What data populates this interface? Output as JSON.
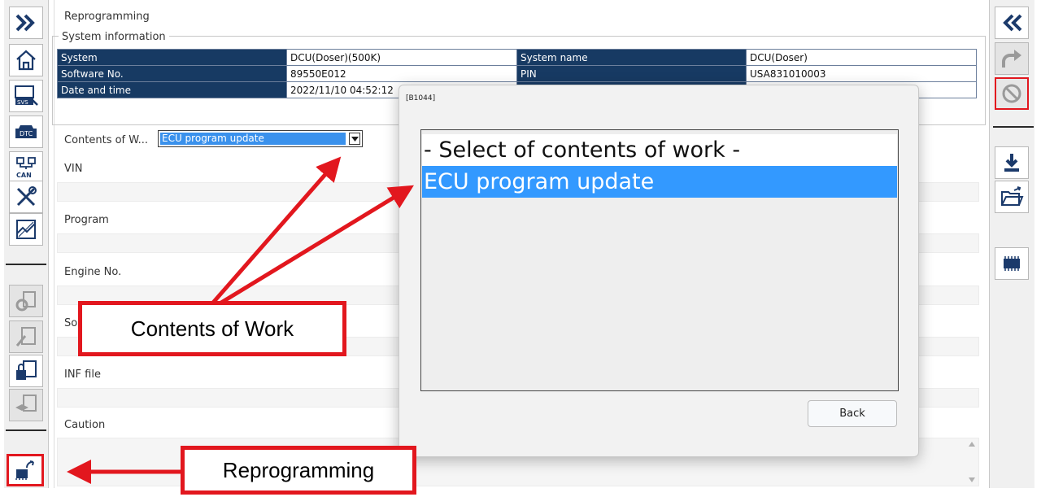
{
  "panel": {
    "title": "Reprogramming",
    "section_title": "System information"
  },
  "system_info": [
    [
      "System",
      "DCU(Doser)(500K)",
      "System name",
      "DCU(Doser)"
    ],
    [
      "Software No.",
      "89550E012",
      "PIN",
      "USA831010003"
    ],
    [
      "Date and time",
      "2022/11/10 04:52:12",
      "",
      ""
    ]
  ],
  "form": {
    "contents_label": "Contents of W...",
    "contents_value": "ECU program update",
    "vin_label": "VIN",
    "program_label": "Program",
    "engine_label": "Engine No.",
    "software_label_partial": "So",
    "inf_label": "INF file",
    "caution_label": "Caution"
  },
  "dialog": {
    "title": "[B1044]",
    "items": [
      "- Select of contents of work -",
      "ECU program update"
    ],
    "selected_index": 1,
    "back_label": "Back"
  },
  "annotations": {
    "contents_of_work": "Contents of Work",
    "reprogramming": "Reprogramming"
  },
  "left_toolbar": [
    "expand-icon",
    "home-icon",
    "svs-icon",
    "dtc-icon",
    "can-icon",
    "tools-icon",
    "monitor-icon",
    "settings-disabled-icon",
    "edit-disabled-icon",
    "lock-settings-icon",
    "training-disabled-icon",
    "reprogramming-icon"
  ],
  "right_toolbar": [
    "collapse-icon",
    "forward-disabled-icon",
    "prohibited-icon",
    "download-icon",
    "open-folder-icon",
    "ecu-chip-icon"
  ],
  "colors": {
    "table_header": "#173a63",
    "selection": "#3399ff",
    "annotation": "#e2171e"
  }
}
